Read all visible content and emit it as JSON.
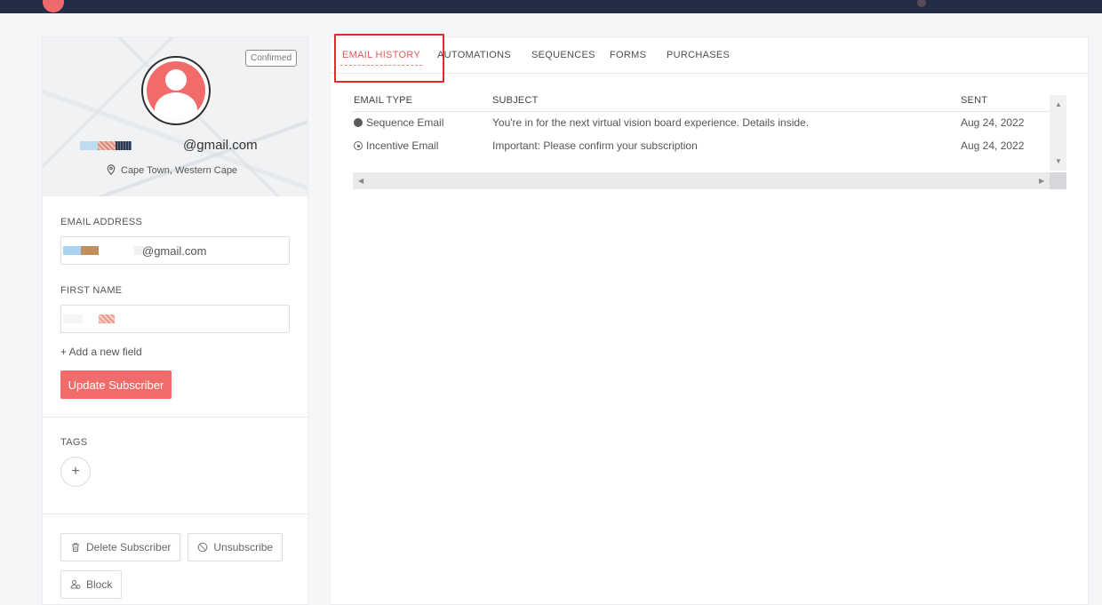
{
  "profile": {
    "status_badge": "Confirmed",
    "email_display_suffix": "@gmail.com",
    "location": "Cape Town, Western Cape"
  },
  "form": {
    "email_label": "EMAIL ADDRESS",
    "email_value_suffix": "@gmail.com",
    "first_name_label": "FIRST NAME",
    "add_field_link": "+ Add a new field",
    "update_button": "Update Subscriber"
  },
  "tags": {
    "label": "TAGS",
    "add_button": "+"
  },
  "actions": {
    "delete": "Delete Subscriber",
    "unsubscribe": "Unsubscribe",
    "block": "Block"
  },
  "tabs": [
    {
      "label": "EMAIL HISTORY"
    },
    {
      "label": "AUTOMATIONS"
    },
    {
      "label": "SEQUENCES"
    },
    {
      "label": "FORMS"
    },
    {
      "label": "PURCHASES"
    }
  ],
  "history": {
    "columns": [
      "EMAIL TYPE",
      "SUBJECT",
      "SENT"
    ],
    "rows": [
      {
        "type": "Sequence Email",
        "subject": "You're in for the next virtual vision board experience. Details inside.",
        "sent": "Aug 24, 2022"
      },
      {
        "type": "Incentive Email",
        "subject": "Important: Please confirm your subscription",
        "sent": "Aug 24, 2022"
      }
    ]
  },
  "colors": {
    "accent": "#f26b6b",
    "topbar": "#242d48",
    "highlight_box": "#e12b2b"
  }
}
